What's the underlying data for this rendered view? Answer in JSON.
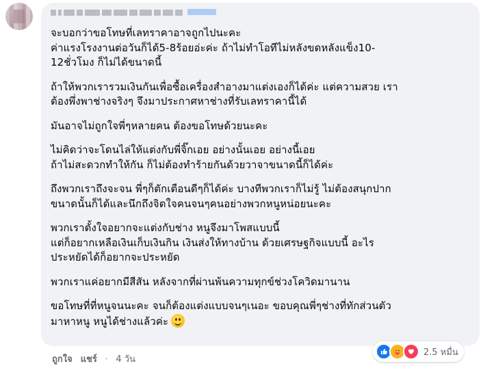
{
  "comment": {
    "lines": [
      [
        "จะบอกว่าขอโทษที่เลทราคาอาจถูกไปนะคะ",
        "ค่าแรงโรงงานต่อวันก็ได้5-8ร้อยอ่ะค่ะ ถ้าไม่ทำโอทีไม่หลังขดหลังแข็ง10-",
        "12ชั่วโมง ก็ไม่ได้ขนาดนี้"
      ],
      [
        "ถ้าให้พวกเรารวมเงินกันเพื่อซื้อเครื่องสำอางมาแต่งเองก็ได้ค่ะ แต่ความสวย เรา",
        "ต้องพึ่งพาช่างจริงๆ จึงมาประกาศหาช่างที่รับเลทราคานี้ได้"
      ],
      [
        "มันอาจไม่ถูกใจพี่ๆหลายคน ต้องขอโทษด้วยนะคะ"
      ],
      [
        "ไม่คิดว่าจะโดนไล่ให้แต่งกับพี่จิ๊กเอย อย่างนั้นเอย อย่างนี้เอย",
        "ถ้าไม่สะดวกทำให้กัน ก็ไม่ต้องทำร้ายกันด้วยวาจาขนาดนี้ก็ได้ค่ะ"
      ],
      [
        "ถึงพวกเราถึงจะจน พี่ๆก็ตักเตือนดีๆก็ได้ค่ะ บางทีพวกเราก็ไม่รู้ ไม่ต้องสนุกปาก",
        "ขนาดนั้นก็ได้และนึกถึงจิตใจคนจนๆคนอย่างพวกหนูหน่อยนะคะ"
      ],
      [
        "พวกเราตั้งใจอยากจะแต่งกับช่าง หนูจึงมาโพสแบบนี้",
        "แต่ก็อยากเหลือเงินเก็บเงินกิน เงินส่งให้ทางบ้าน ด้วยเศรษฐกิจแบบนี้ อะไร",
        "ประหยัดได้ก็อยากจะประหยัด"
      ],
      [
        "พวกเราแค่อยากมีสีสัน หลังจากที่ผ่านพ้นความทุกข์ช่วงโควิดมานาน"
      ],
      [
        "ขอโทษที่ที่หนูจนนะคะ จนก็ต้องแต่งแบบจนๆเนอะ ขอบคุณพี่ๆช่างที่ทักส่วนตัว",
        "มาหาหนู หนูได้ช่างแล้วค่ะ"
      ]
    ],
    "emoji": "smiling-face-emoji"
  },
  "reactions": {
    "types": [
      "like-icon",
      "care-icon",
      "love-icon"
    ],
    "count": "2.5 หมื่น",
    "colors": {
      "like": "#1877f2",
      "care": "#f7b125",
      "love": "#f33e58"
    }
  },
  "actions": {
    "like_label": "ถูกใจ",
    "share_label": "แชร์",
    "separator": "·",
    "time": "4 วัน"
  }
}
